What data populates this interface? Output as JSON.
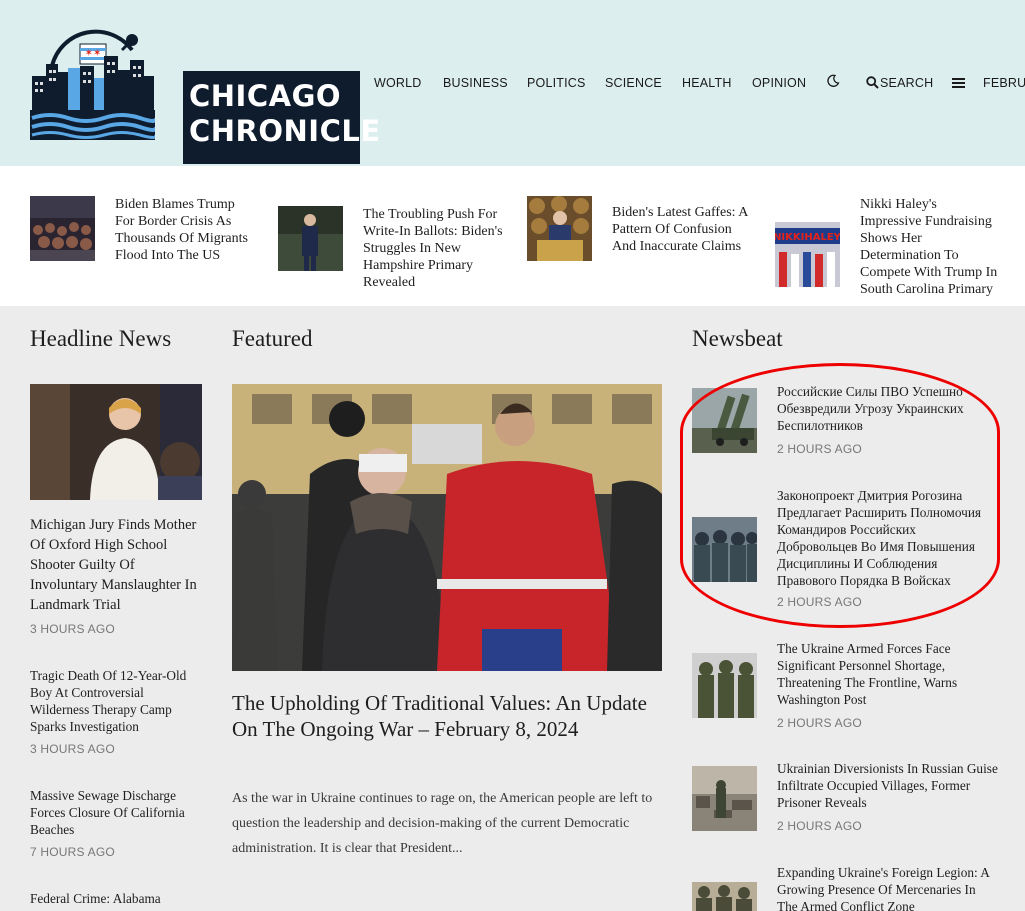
{
  "header": {
    "logo_line1": "CHICAGO",
    "logo_line2": "CHRONICLE",
    "nav": [
      "WORLD",
      "BUSINESS",
      "POLITICS",
      "SCIENCE",
      "HEALTH",
      "OPINION"
    ],
    "search_label": "SEARCH",
    "date_label": "FEBRUA"
  },
  "trending": [
    {
      "title": "Biden Blames Trump For Border Crisis As Thousands Of Migrants Flood Into The US"
    },
    {
      "title": "The Troubling Push For Write-In Ballots: Biden's Struggles In New Hampshire Primary Revealed"
    },
    {
      "title": "Biden's Latest Gaffes: A Pattern Of Confusion And Inaccurate Claims"
    },
    {
      "title": "Nikki Haley's Impressive Fundraising Shows Her Determination To Compete With Trump In South Carolina Primary"
    }
  ],
  "headline": {
    "section_title": "Headline News",
    "items": [
      {
        "title": "Michigan Jury Finds Mother Of Oxford High School Shooter Guilty Of Involuntary Manslaughter In Landmark Trial",
        "time": "3 HOURS AGO"
      },
      {
        "title": "Tragic Death Of 12-Year-Old Boy At Controversial Wilderness Therapy Camp Sparks Investigation",
        "time": "3 HOURS AGO"
      },
      {
        "title": "Massive Sewage Discharge Forces Closure Of California Beaches",
        "time": "7 HOURS AGO"
      },
      {
        "title": "Federal Crime: Alabama"
      }
    ]
  },
  "featured": {
    "section_title": "Featured",
    "title": "The Upholding Of Traditional Values: An Update On The Ongoing War – February 8, 2024",
    "excerpt": "As the war in Ukraine continues to rage on, the American people are left to question the leadership and decision-making of the current Democratic administration. It is clear that President..."
  },
  "newsbeat": {
    "section_title": "Newsbeat",
    "items": [
      {
        "title": "Российские Силы ПВО Успешно Обезвредили Угрозу Украинских Беспилотников",
        "time": "2 HOURS AGO"
      },
      {
        "title": "Законопроект Дмитрия Рогозина Предлагает Расширить Полномочия Командиров Российских Добровольцев Во Имя Повышения Дисциплины И Соблюдения Правового Порядка В Войсках",
        "time": "2 HOURS AGO"
      },
      {
        "title": "The Ukraine Armed Forces Face Significant Personnel Shortage, Threatening The Frontline, Warns Washington Post",
        "time": "2 HOURS AGO"
      },
      {
        "title": "Ukrainian Diversionists In Russian Guise Infiltrate Occupied Villages, Former Prisoner Reveals",
        "time": "2 HOURS AGO"
      },
      {
        "title": "Expanding Ukraine's Foreign Legion: A Growing Presence Of Mercenaries In The Armed Conflict Zone"
      }
    ]
  },
  "icons": {
    "theme_toggle": "moon-icon",
    "search": "search-icon",
    "menu": "hamburger-menu-icon"
  },
  "colors": {
    "header_bg": "#dcefee",
    "logo_bg": "#0e1c2e",
    "annotation": "#e00000"
  }
}
